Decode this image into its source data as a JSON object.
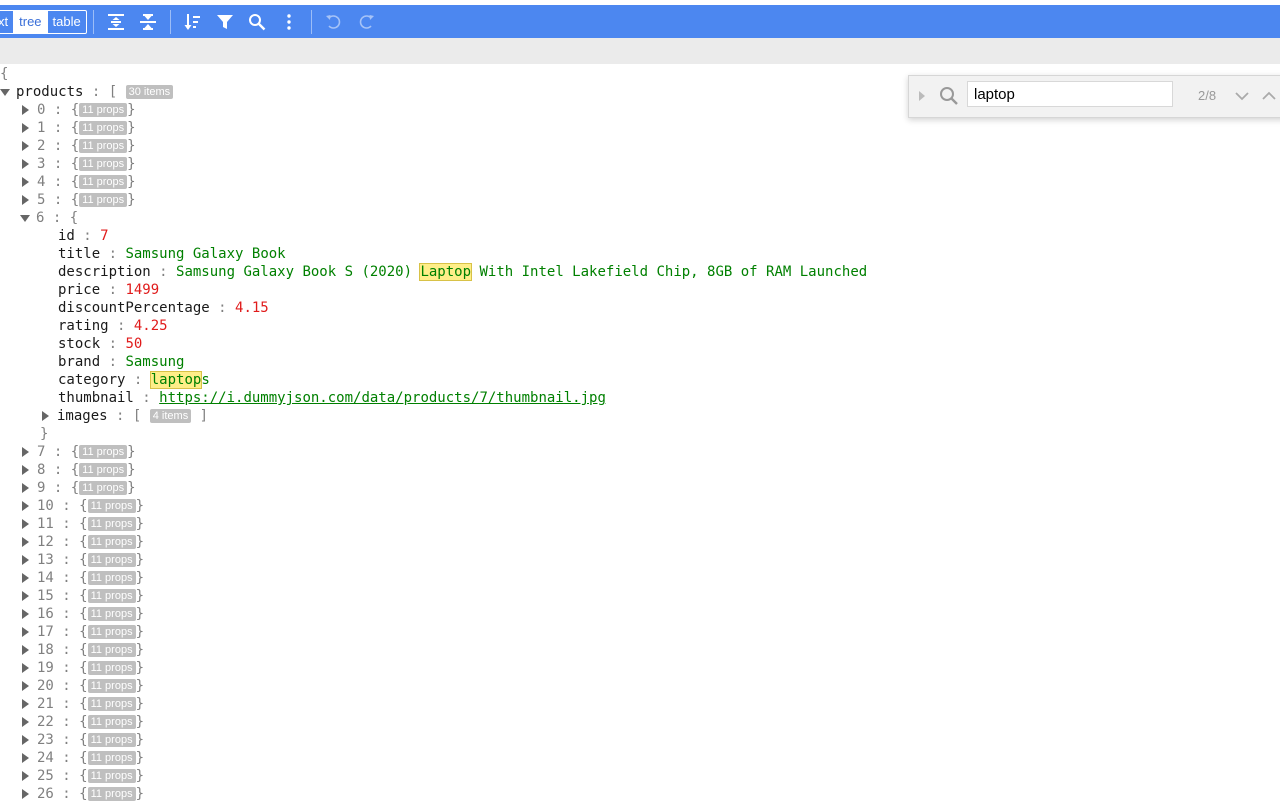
{
  "toolbar": {
    "modes": [
      "xt",
      "tree",
      "table"
    ],
    "active_mode": "tree",
    "buttons": [
      "expand-all-icon",
      "collapse-all-icon",
      "sort-icon",
      "filter-icon",
      "search-icon",
      "more-icon",
      "undo-icon",
      "redo-icon"
    ]
  },
  "search": {
    "value": "laptop",
    "count": "2/8"
  },
  "tree": {
    "root_open": "{",
    "products_key": "products",
    "products_badge": "30 items",
    "props_badge": "11 props",
    "expanded_index": "6",
    "collapsed_before": [
      "0",
      "1",
      "2",
      "3",
      "4",
      "5"
    ],
    "collapsed_after": [
      "7",
      "8",
      "9",
      "10",
      "11",
      "12",
      "13",
      "14",
      "15",
      "16",
      "17",
      "18",
      "19",
      "20",
      "21",
      "22",
      "23",
      "24",
      "25",
      "26"
    ],
    "item": {
      "id": {
        "key": "id",
        "value": "7"
      },
      "title": {
        "key": "title",
        "value": "Samsung Galaxy Book"
      },
      "description": {
        "key": "description",
        "before": "Samsung Galaxy Book S (2020) ",
        "match": "Laptop",
        "after": " With Intel Lakefield Chip, 8GB of RAM Launched"
      },
      "price": {
        "key": "price",
        "value": "1499"
      },
      "discountPercentage": {
        "key": "discountPercentage",
        "value": "4.15"
      },
      "rating": {
        "key": "rating",
        "value": "4.25"
      },
      "stock": {
        "key": "stock",
        "value": "50"
      },
      "brand": {
        "key": "brand",
        "value": "Samsung"
      },
      "category": {
        "key": "category",
        "match": "laptop",
        "after": "s"
      },
      "thumbnail": {
        "key": "thumbnail",
        "value": "https://i.dummyjson.com/data/products/7/thumbnail.jpg"
      },
      "images": {
        "key": "images",
        "badge": "4 items"
      }
    }
  }
}
